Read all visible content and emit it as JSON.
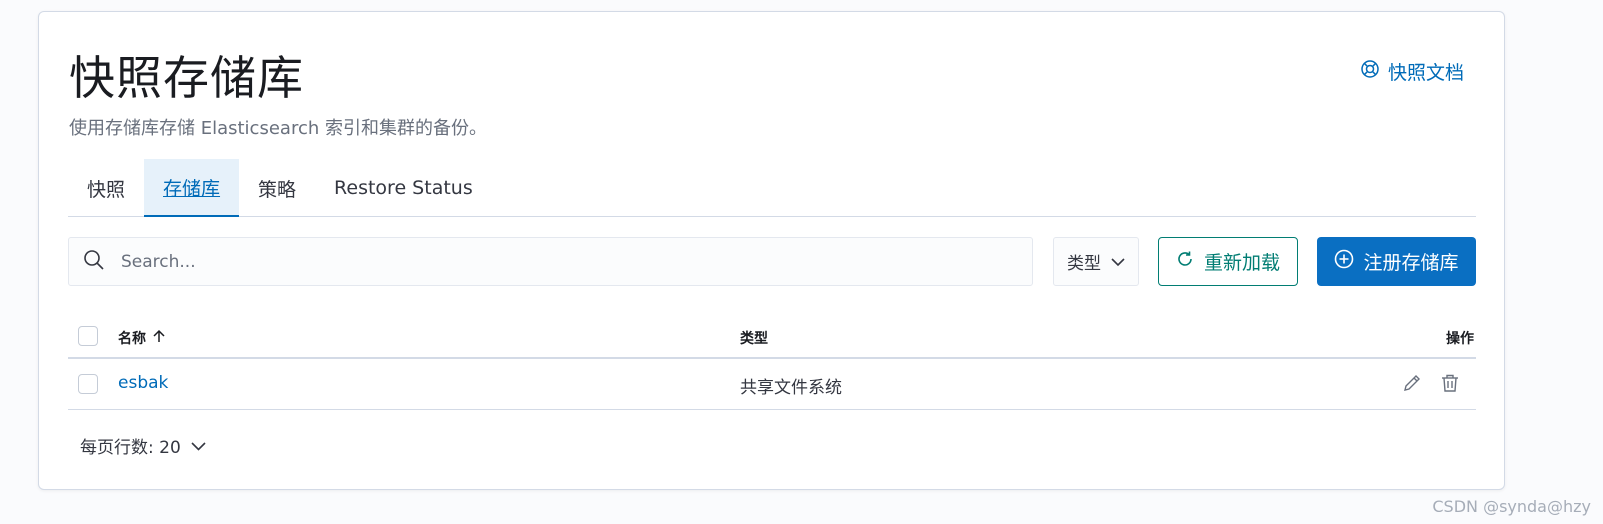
{
  "header": {
    "title": "快照存储库",
    "docs_link": "快照文档",
    "subtitle": "使用存储库存储 Elasticsearch 索引和集群的备份。"
  },
  "tabs": [
    {
      "label": "快照",
      "active": false
    },
    {
      "label": "存储库",
      "active": true
    },
    {
      "label": "策略",
      "active": false
    },
    {
      "label": "Restore Status",
      "active": false
    }
  ],
  "toolbar": {
    "search_placeholder": "Search...",
    "type_filter_label": "类型",
    "reload_label": "重新加载",
    "register_label": "注册存储库"
  },
  "table": {
    "columns": {
      "name": "名称",
      "type": "类型",
      "actions": "操作"
    },
    "rows": [
      {
        "name": "esbak",
        "type": "共享文件系统"
      }
    ]
  },
  "pagination": {
    "rows_per_page": "每页行数: 20"
  },
  "watermark": "CSDN @synda@hzy",
  "colors": {
    "link": "#006bb8",
    "reload_border": "#017d73",
    "primary_button": "#0a6fc2",
    "active_tab_bg": "#e6f1fa",
    "border": "#d3dae6"
  },
  "icons": {
    "docs": "help-lifebuoy-icon",
    "search": "search-icon",
    "filter": "chevron-down-icon",
    "reload": "refresh-icon",
    "register": "plus-circle-icon",
    "sort": "arrow-up-icon",
    "edit": "pencil-icon",
    "delete": "trash-icon"
  }
}
